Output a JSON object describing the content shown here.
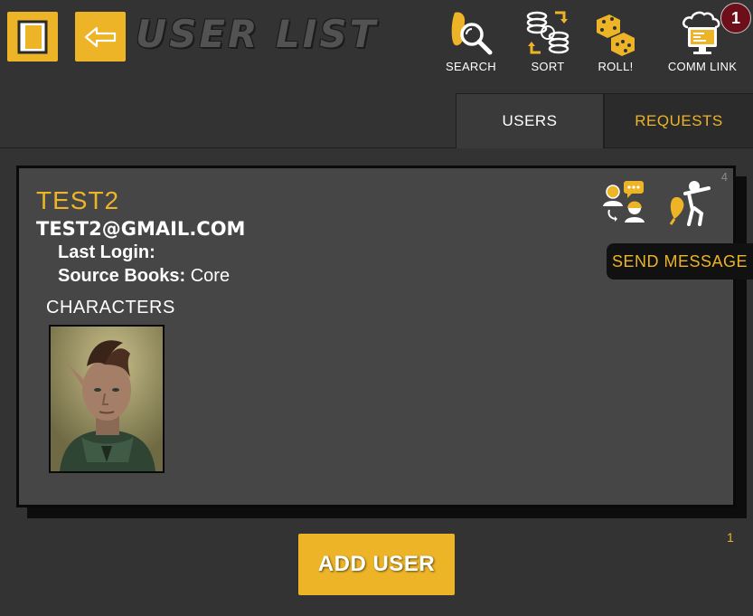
{
  "header": {
    "app_title": "USER LIST",
    "panel_button_icon": "sidebar-panel-icon",
    "back_button_icon": "back-arrow-icon"
  },
  "toolbar": {
    "search_label": "SEARCH",
    "sort_label": "SORT",
    "roll_label": "ROLL!",
    "comm_link_label": "COMM LINK",
    "comm_link_badge": "1"
  },
  "tabs": [
    {
      "label": "USERS",
      "active": true
    },
    {
      "label": "REQUESTS",
      "active": false
    }
  ],
  "user_card": {
    "index": "4",
    "name": "TEST2",
    "email": "TEST2@GMAIL.COM",
    "last_login_label": "Last Login:",
    "last_login_value": "",
    "source_books_label": "Source Books:",
    "source_books_value": "Core",
    "characters_heading": "CHARACTERS",
    "message_icon": "chat-users-icon",
    "kick_icon": "remove-user-icon",
    "tooltip": "SEND MESSAGE"
  },
  "pagination": {
    "page": "1"
  },
  "add_user_label": "ADD USER",
  "colors": {
    "accent": "#ecb426",
    "background": "#333334",
    "card": "#464647",
    "badge": "#6d0f1a"
  }
}
